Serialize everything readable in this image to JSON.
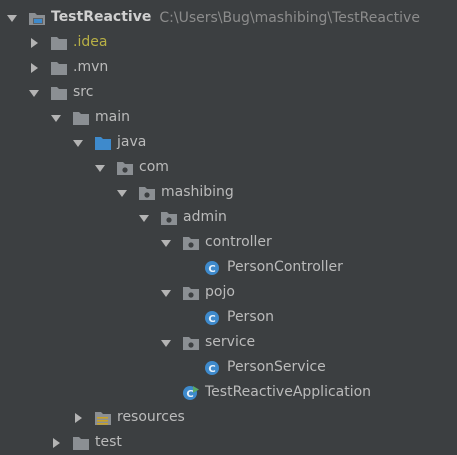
{
  "tree": {
    "project": {
      "name": "TestReactive",
      "path": "C:\\Users\\Bug\\mashibing\\TestReactive"
    },
    "idea": "idea",
    "idea_prefix": ".",
    "mvn": ".mvn",
    "src": "src",
    "main": "main",
    "java": "java",
    "com": "com",
    "mashibing": "mashibing",
    "admin": "admin",
    "controller": "controller",
    "person_controller": "PersonController",
    "pojo": "pojo",
    "person": "Person",
    "service": "service",
    "person_service": "PersonService",
    "app": "TestReactiveApplication",
    "resources": "resources",
    "test": "test"
  },
  "colors": {
    "background": "#3c3f41",
    "text": "#bbbbbb",
    "excluded": "#b8b045",
    "folder": "#8b8f93",
    "source_folder": "#3e8acc",
    "class_icon": "#3e8acc"
  },
  "icons": {
    "folder": "folder-icon",
    "source_folder": "source-folder-icon",
    "package": "package-icon",
    "class": "java-class-icon",
    "app": "spring-boot-app-icon",
    "resources": "resources-folder-icon",
    "project": "project-module-icon"
  }
}
